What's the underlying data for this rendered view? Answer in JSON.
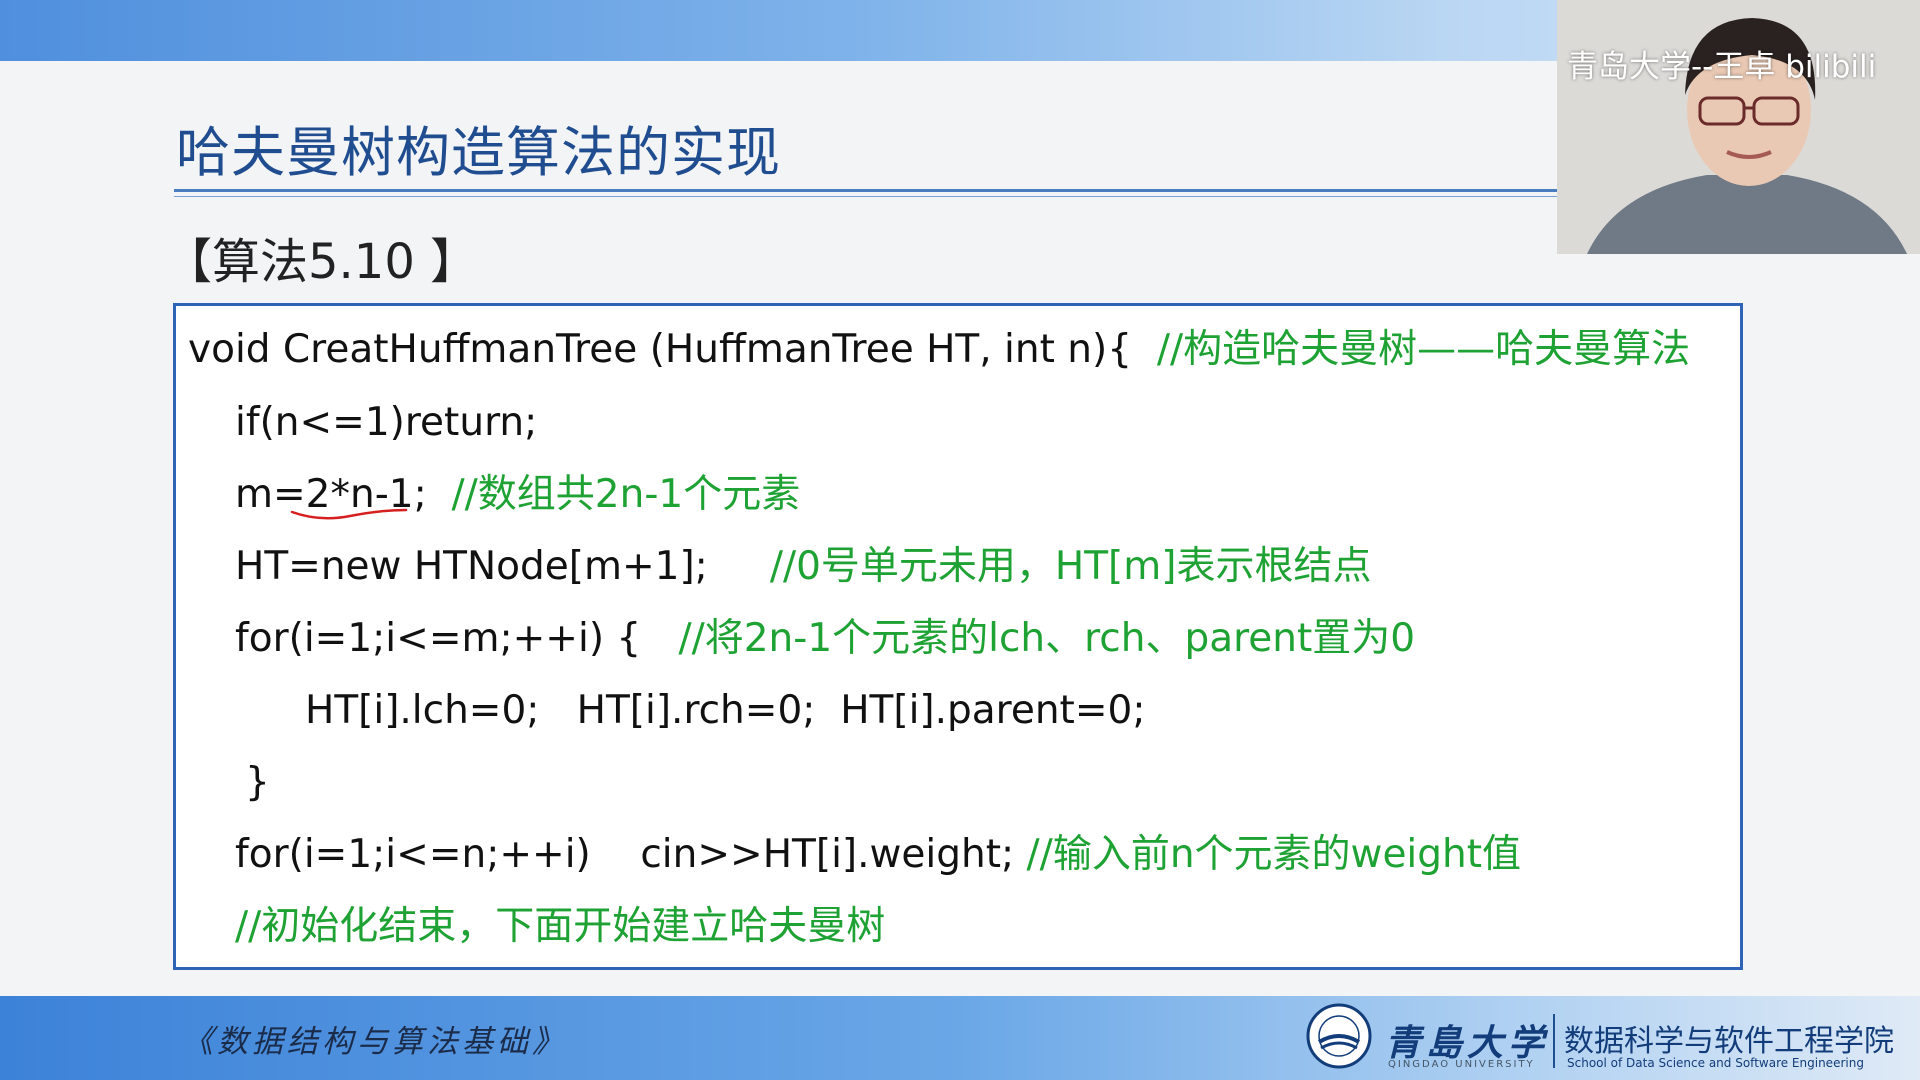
{
  "slide": {
    "title": "哈夫曼树构造算法的实现",
    "algorithm_label": "【算法5.10 】"
  },
  "code": {
    "lines": [
      {
        "code": "void CreatHuffmanTree (HuffmanTree HT, int n){  ",
        "comment": "//构造哈夫曼树——哈夫曼算法"
      },
      {
        "code": "if(n<=1)return;",
        "comment": ""
      },
      {
        "code": "m=2*n-1;  ",
        "comment": "//数组共2n-1个元素"
      },
      {
        "code": "HT=new HTNode[m+1];     ",
        "comment": "//0号单元未用，HT[m]表示根结点"
      },
      {
        "code": "for(i=1;i<=m;++i) {   ",
        "comment": "//将2n-1个元素的lch、rch、parent置为0"
      },
      {
        "code": "HT[i].lch=0;   HT[i].rch=0;  HT[i].parent=0;",
        "comment": ""
      },
      {
        "code": "}",
        "comment": ""
      },
      {
        "code": "for(i=1;i<=n;++i)    cin>>HT[i].weight; ",
        "comment": "//输入前n个元素的weight值"
      },
      {
        "code": "",
        "comment": "//初始化结束，下面开始建立哈夫曼树"
      }
    ]
  },
  "webcam": {
    "overlay_text": "青岛大学--王卓 bilibili"
  },
  "footer": {
    "course_name": "《数据结构与算法基础》",
    "university_name": "青島大学",
    "university_en": "QINGDAO UNIVERSITY",
    "school_cn": "数据科学与软件工程学院",
    "school_en": "School of Data Science and Software Engineering"
  },
  "colors": {
    "title": "#1f4d8f",
    "comment": "#1ea233",
    "code": "#111111",
    "box_border": "#2f63b8",
    "annotation": "#d62020"
  }
}
